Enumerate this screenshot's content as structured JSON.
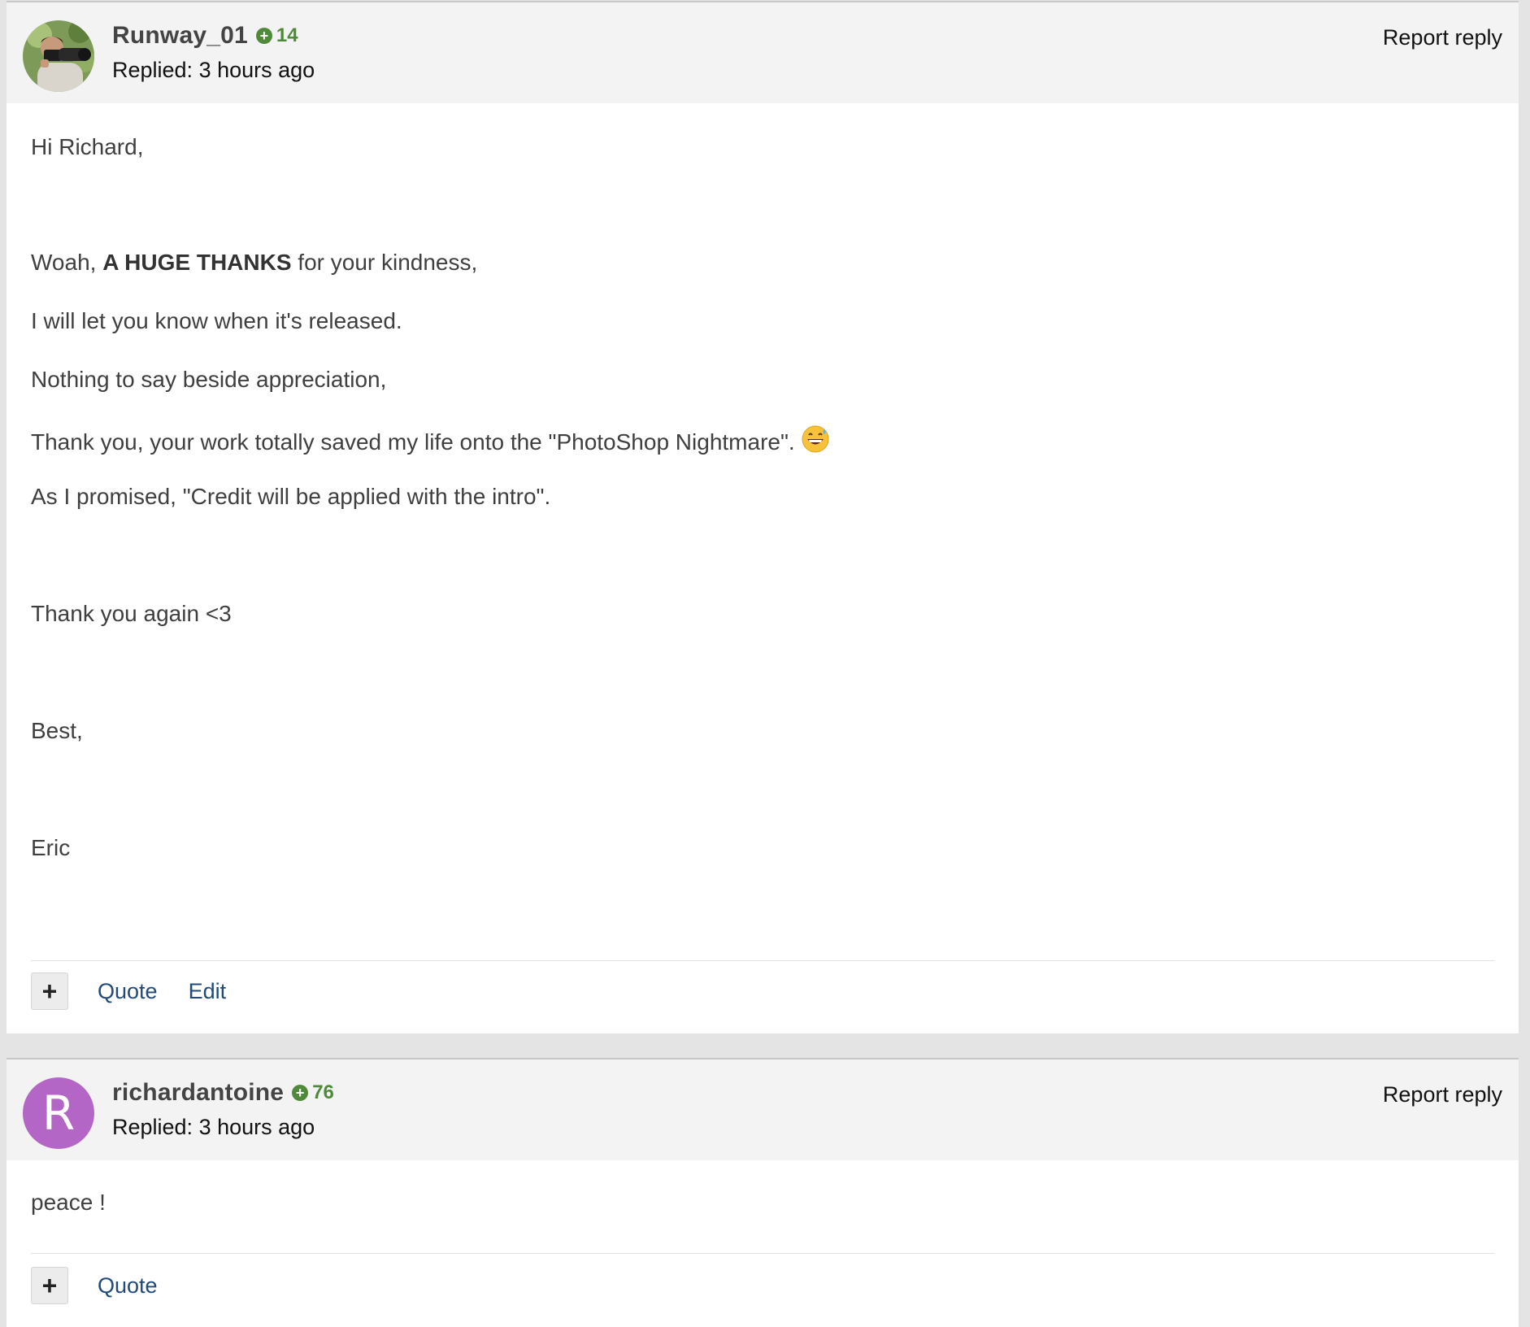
{
  "posts": [
    {
      "username": "Runway_01",
      "reputation": "14",
      "replied": "Replied: 3 hours ago",
      "report_label": "Report reply",
      "avatar": "photographer-photo",
      "body": {
        "greeting": "Hi Richard,",
        "line1_pre": "Woah, ",
        "line1_bold": "A HUGE THANKS",
        "line1_post": " for your kindness,",
        "line2": "I will let you know when it's released.",
        "line3": "Nothing to say beside appreciation,",
        "line4": "Thank you, your work totally saved my life onto the \"PhotoShop Nightmare\".",
        "line4_emoji": "grinning-sweat-emoji",
        "line5": "As I promised, \"Credit will be applied with the intro\".",
        "line6": "Thank you again <3",
        "line7": "Best,",
        "line8": "Eric"
      },
      "actions": {
        "plus": "+",
        "quote": "Quote",
        "edit": "Edit"
      }
    },
    {
      "username": "richardantoine",
      "reputation": "76",
      "replied": "Replied: 3 hours ago",
      "report_label": "Report reply",
      "avatar_letter": "R",
      "avatar_color": "#b466c6",
      "body": {
        "line1": "peace !"
      },
      "actions": {
        "plus": "+",
        "quote": "Quote"
      }
    }
  ],
  "colors": {
    "reputation": "#4e8a3a",
    "link": "#214a7a",
    "header_bg": "#f3f3f3",
    "page_bg": "#e4e4e4"
  }
}
